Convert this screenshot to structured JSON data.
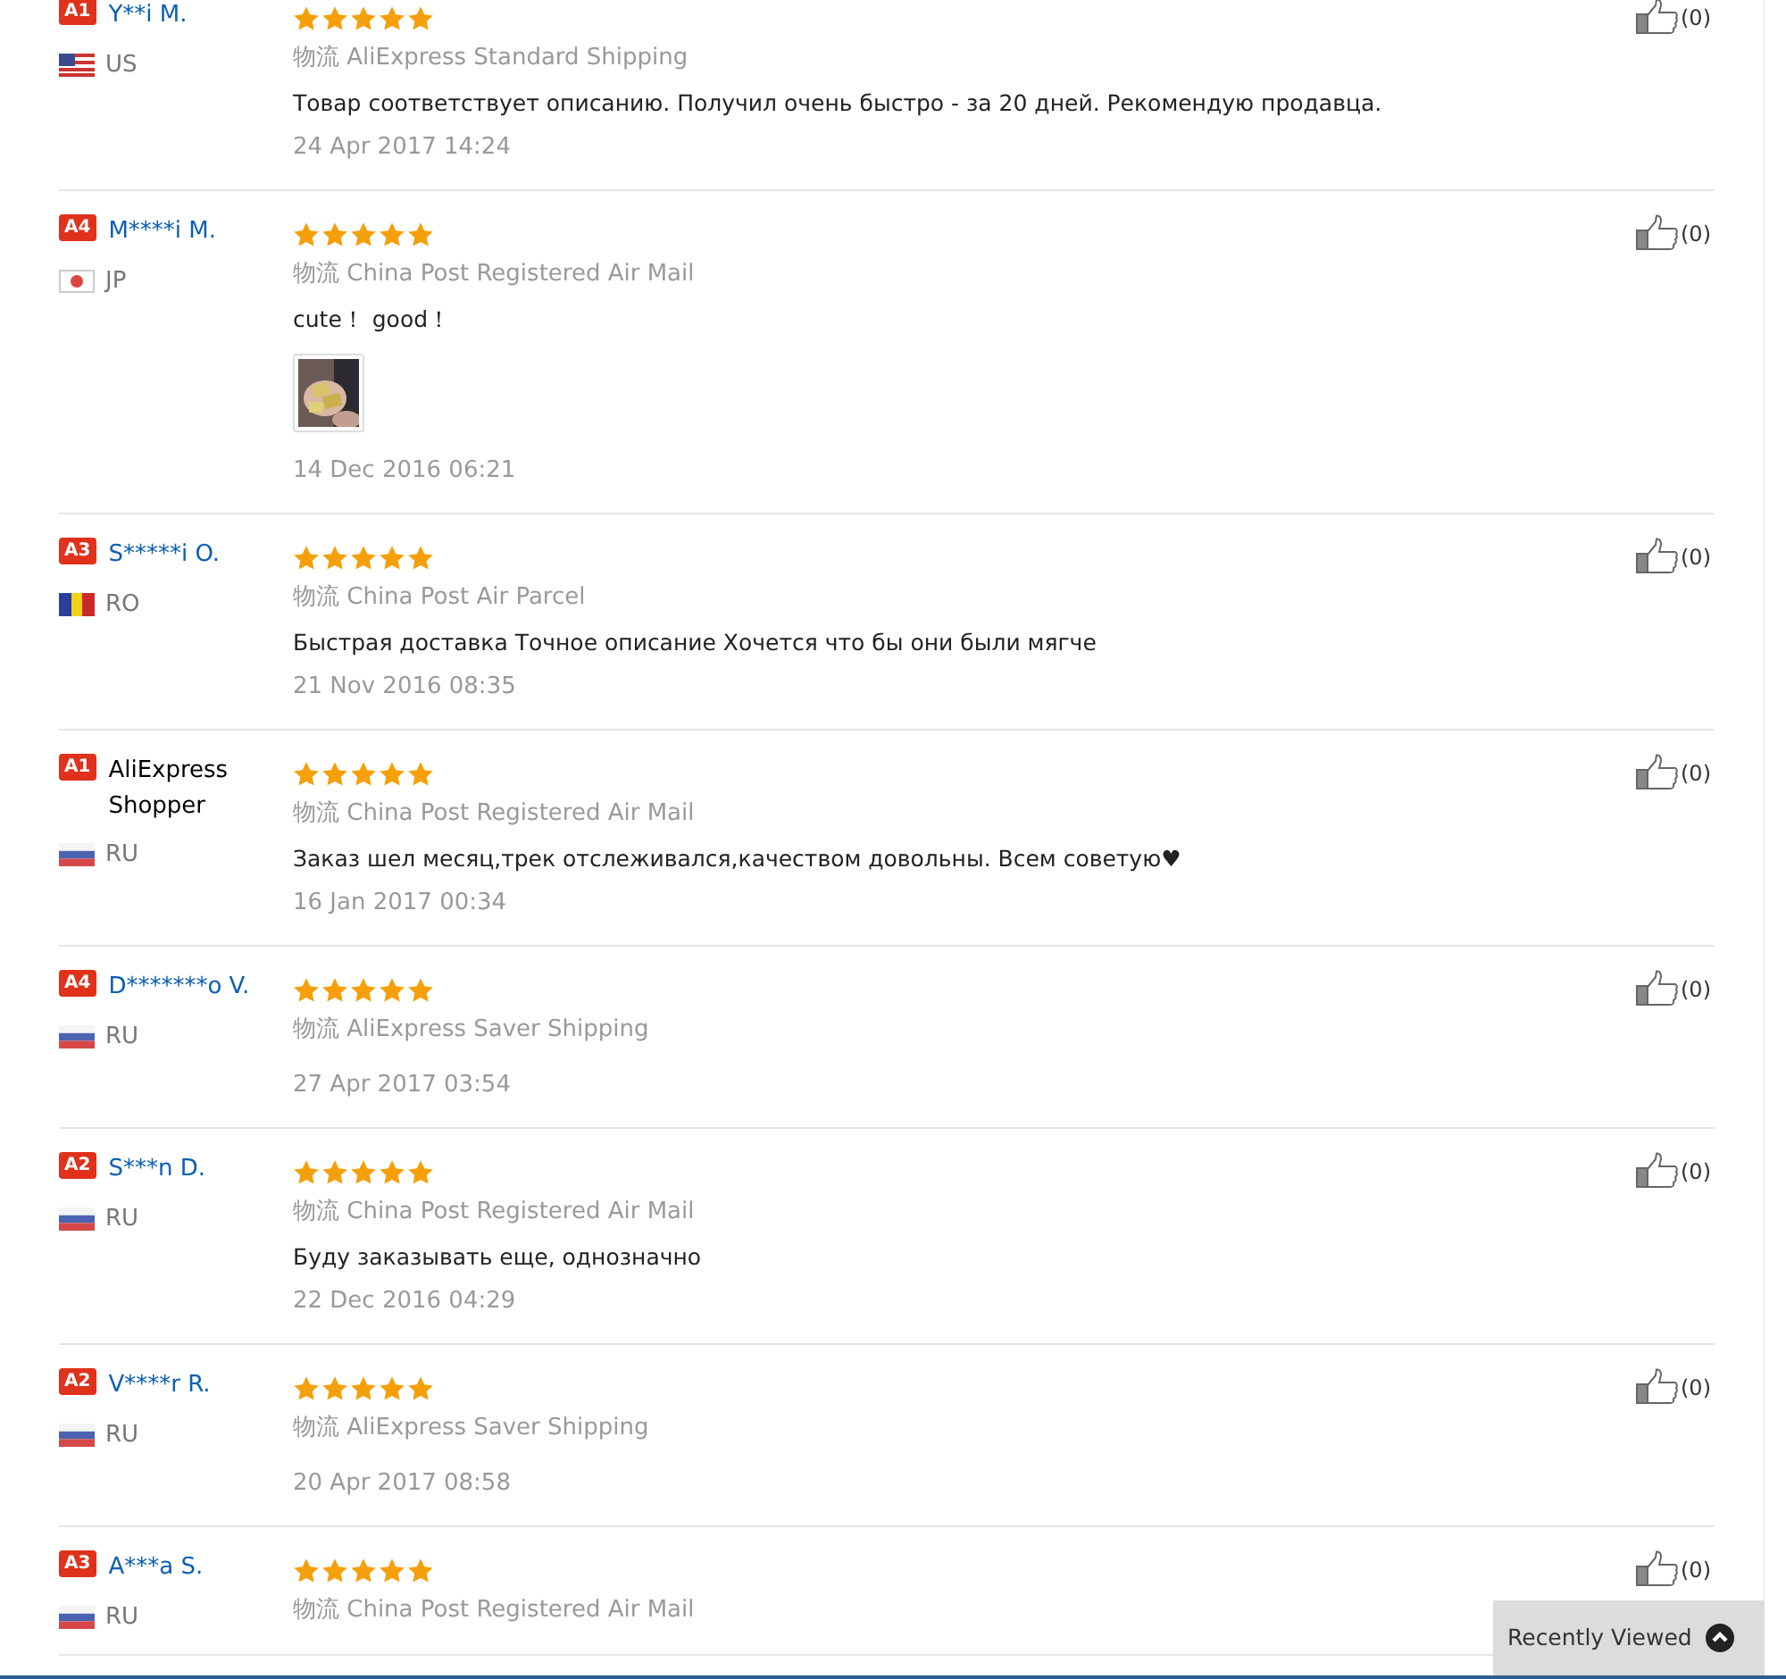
{
  "reviews": [
    {
      "badge": "A1",
      "name": "Y**i M.",
      "linked": true,
      "flag": {
        "kind": "stars-stripes"
      },
      "country": "US",
      "stars": 5,
      "logistics_label": "物流",
      "shipping": "AliExpress Standard Shipping",
      "text": "Товар соответствует описанию. Получил очень быстро - за 20 дней. Рекомендую продавца.",
      "date": "24 Apr 2017 14:24",
      "helpful": "(0)"
    },
    {
      "badge": "A4",
      "name": "M****i M.",
      "linked": true,
      "flag": {
        "kind": "disc"
      },
      "country": "JP",
      "stars": 5,
      "logistics_label": "物流",
      "shipping": "China Post Registered Air Mail",
      "text": "cute！ good！",
      "photos": [
        {
          "kind": "picture"
        }
      ],
      "date": "14 Dec 2016 06:21",
      "helpful": "(0)"
    },
    {
      "badge": "A3",
      "name": "S*****i O.",
      "linked": true,
      "flag": {
        "kind": "vertical-stripes"
      },
      "country": "RO",
      "stars": 5,
      "logistics_label": "物流",
      "shipping": "China Post Air Parcel",
      "text": "Быстрая доставка Точное описание Хочется что бы они были мягче",
      "date": "21 Nov 2016 08:35",
      "helpful": "(0)"
    },
    {
      "badge": "A1",
      "name": "AliExpress Shopper",
      "linked": false,
      "flag": {
        "kind": "horizontal-stripes"
      },
      "country": "RU",
      "stars": 5,
      "logistics_label": "物流",
      "shipping": "China Post Registered Air Mail",
      "text": "Заказ шел месяц,трек отслеживался,качеством довольны. Всем советую♥",
      "date": "16 Jan 2017 00:34",
      "helpful": "(0)"
    },
    {
      "badge": "A4",
      "name": "D*******o V.",
      "linked": true,
      "flag": {
        "kind": "horizontal-stripes"
      },
      "country": "RU",
      "stars": 5,
      "logistics_label": "物流",
      "shipping": "AliExpress Saver Shipping",
      "date": "27 Apr 2017 03:54",
      "helpful": "(0)"
    },
    {
      "badge": "A2",
      "name": "S***n D.",
      "linked": true,
      "flag": {
        "kind": "horizontal-stripes"
      },
      "country": "RU",
      "stars": 5,
      "logistics_label": "物流",
      "shipping": "China Post Registered Air Mail",
      "text": "Буду заказывать еще, однозначно",
      "date": "22 Dec 2016 04:29",
      "helpful": "(0)"
    },
    {
      "badge": "A2",
      "name": "V****r R.",
      "linked": true,
      "flag": {
        "kind": "horizontal-stripes"
      },
      "country": "RU",
      "stars": 5,
      "logistics_label": "物流",
      "shipping": "AliExpress Saver Shipping",
      "date": "20 Apr 2017 08:58",
      "helpful": "(0)"
    },
    {
      "badge": "A3",
      "name": "A***a S.",
      "linked": true,
      "flag": {
        "kind": "horizontal-stripes"
      },
      "country": "RU",
      "stars": 5,
      "logistics_label": "物流",
      "shipping": "China Post Registered Air Mail",
      "helpful": "(0)"
    }
  ],
  "recently_viewed": {
    "label": "Recently Viewed",
    "expanded": false
  }
}
